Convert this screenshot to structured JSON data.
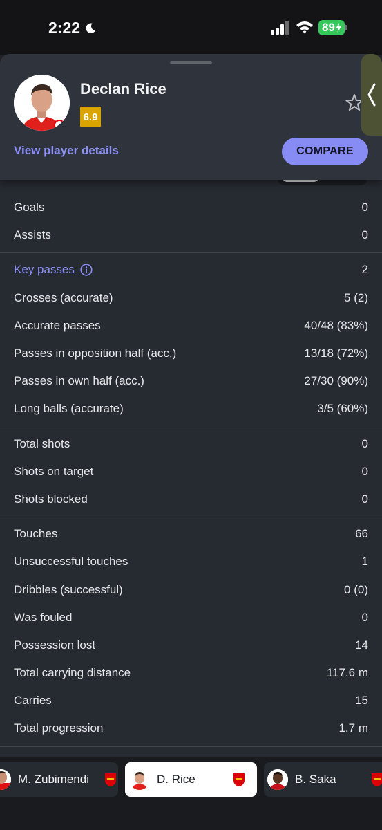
{
  "status_bar": {
    "time": "2:22",
    "battery": "89"
  },
  "player": {
    "name": "Declan Rice",
    "rating": "6.9"
  },
  "header": {
    "view_link": "View player details",
    "compare_label": "COMPARE"
  },
  "stats": {
    "group1": [
      {
        "label": "Goals",
        "value": "0"
      },
      {
        "label": "Assists",
        "value": "0"
      }
    ],
    "group2": [
      {
        "label": "Key passes",
        "value": "2"
      },
      {
        "label": "Crosses (accurate)",
        "value": "5 (2)"
      },
      {
        "label": "Accurate passes",
        "value": "40/48 (83%)"
      },
      {
        "label": "Passes in opposition half (acc.)",
        "value": "13/18 (72%)"
      },
      {
        "label": "Passes in own half (acc.)",
        "value": "27/30 (90%)"
      },
      {
        "label": "Long balls (accurate)",
        "value": "3/5 (60%)"
      }
    ],
    "group3": [
      {
        "label": "Total shots",
        "value": "0"
      },
      {
        "label": "Shots on target",
        "value": "0"
      },
      {
        "label": "Shots blocked",
        "value": "0"
      }
    ],
    "group4": [
      {
        "label": "Touches",
        "value": "66"
      },
      {
        "label": "Unsuccessful touches",
        "value": "1"
      },
      {
        "label": "Dribbles (successful)",
        "value": "0 (0)"
      },
      {
        "label": "Was fouled",
        "value": "0"
      },
      {
        "label": "Possession lost",
        "value": "14"
      },
      {
        "label": "Total carrying distance",
        "value": "117.6 m"
      },
      {
        "label": "Carries",
        "value": "15"
      },
      {
        "label": "Total progression",
        "value": "1.7 m"
      }
    ]
  },
  "player_switcher": [
    {
      "name": "M. Zubimendi",
      "active": false
    },
    {
      "name": "D. Rice",
      "active": true
    },
    {
      "name": "B. Saka",
      "active": false
    }
  ],
  "colors": {
    "accent": "#878cf5",
    "link": "#8c8ff5",
    "rating": "#d9a400",
    "battery": "#34c759"
  }
}
